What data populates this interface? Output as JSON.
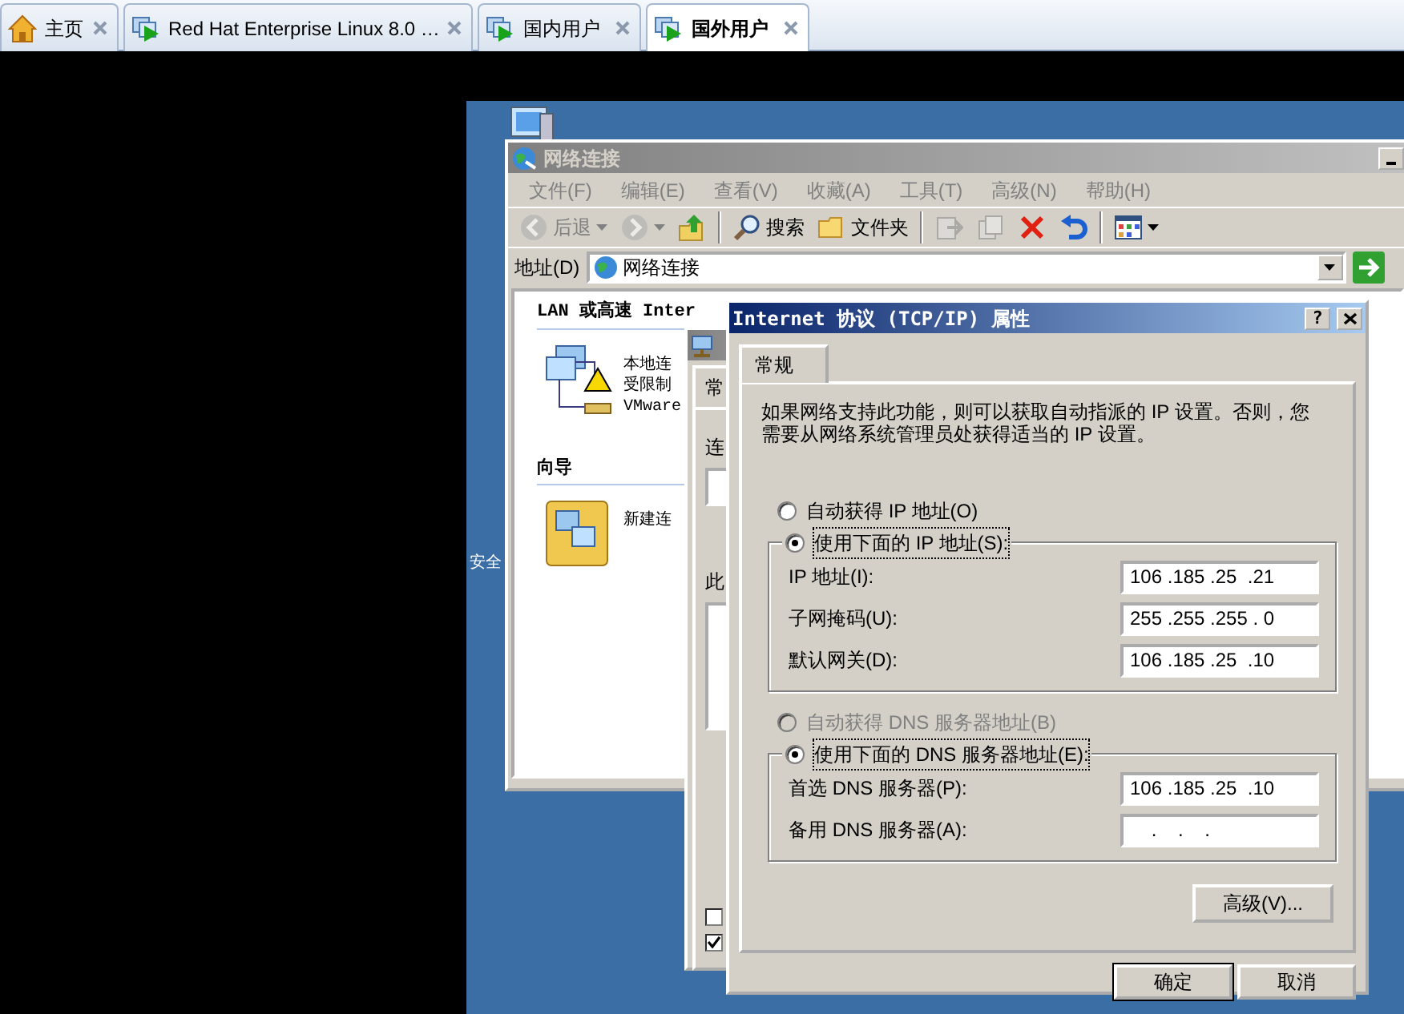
{
  "browser_tabs": [
    {
      "label": "主页",
      "kind": "home",
      "selected": false
    },
    {
      "label": "Red Hat Enterprise Linux 8.0 …",
      "kind": "vm",
      "selected": false
    },
    {
      "label": "国内用户",
      "kind": "vm",
      "selected": false
    },
    {
      "label": "国外用户",
      "kind": "vm",
      "selected": true
    }
  ],
  "desktop": {
    "icon_labels": [
      "安全"
    ]
  },
  "explorer": {
    "title": "网络连接",
    "menu": [
      "文件(F)",
      "编辑(E)",
      "查看(V)",
      "收藏(A)",
      "工具(T)",
      "高级(N)",
      "帮助(H)"
    ],
    "toolbar": [
      {
        "kind": "back",
        "label": "后退",
        "disabled": true
      },
      {
        "kind": "forward",
        "disabled": true
      },
      {
        "kind": "up",
        "disabled": false
      },
      {
        "kind": "search",
        "label": "搜索",
        "disabled": false
      },
      {
        "kind": "folders",
        "label": "文件夹",
        "disabled": false
      },
      {
        "kind": "move",
        "disabled": true
      },
      {
        "kind": "copy",
        "disabled": true
      },
      {
        "kind": "delete",
        "disabled": false
      },
      {
        "kind": "undo",
        "disabled": false
      },
      {
        "kind": "views",
        "disabled": false
      }
    ],
    "address": {
      "label": "地址(D)",
      "value": "网络连接"
    },
    "sections": [
      {
        "header": "LAN 或高速 Inter",
        "items": [
          {
            "kind": "lan",
            "lines": [
              "本地连",
              "受限制",
              "VMware"
            ]
          }
        ]
      },
      {
        "header": "向导",
        "items": [
          {
            "kind": "wizard",
            "lines": [
              "新建连"
            ]
          }
        ]
      }
    ]
  },
  "connection_dialog": {
    "tab": "常",
    "labels": [
      "连",
      "此"
    ],
    "checkboxes": [
      {
        "checked": false
      },
      {
        "checked": true
      }
    ]
  },
  "tcpip_dialog": {
    "title": "Internet 协议 (TCP/IP) 属性",
    "tab": "常规",
    "description": "如果网络支持此功能，则可以获取自动指派的 IP 设置。否则，您需要从网络系统管理员处获得适当的 IP 设置。",
    "ip_options": [
      {
        "label": "自动获得 IP 地址(O)",
        "selected": false,
        "disabled": false
      },
      {
        "label": "使用下面的 IP 地址(S):",
        "selected": true,
        "disabled": false
      }
    ],
    "ip_fields": [
      {
        "label": "IP 地址(I):",
        "value": "106 .185 .25  .21"
      },
      {
        "label": "子网掩码(U):",
        "value": "255 .255 .255 . 0"
      },
      {
        "label": "默认网关(D):",
        "value": "106 .185 .25  .10"
      }
    ],
    "dns_options": [
      {
        "label": "自动获得 DNS 服务器地址(B)",
        "selected": false,
        "disabled": true
      },
      {
        "label": "使用下面的 DNS 服务器地址(E):",
        "selected": true,
        "disabled": false
      }
    ],
    "dns_fields": [
      {
        "label": "首选 DNS 服务器(P):",
        "value": "106 .185 .25  .10"
      },
      {
        "label": "备用 DNS 服务器(A):",
        "value": "    .    .    ."
      }
    ],
    "help_button": "?",
    "advanced_button": "高级(V)...",
    "buttons": [
      {
        "label": "确定",
        "default": true
      },
      {
        "label": "取消",
        "default": false
      }
    ]
  }
}
